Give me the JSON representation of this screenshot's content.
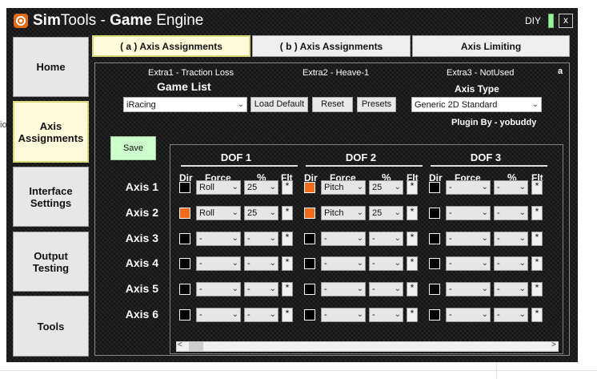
{
  "window": {
    "title_sim": "Sim",
    "title_tools": "Tools",
    "title_dash": " - ",
    "title_game": "Game",
    "title_engine": " Engine",
    "diy_label": "DIY",
    "close_label": "x"
  },
  "background": {
    "io_text": "io"
  },
  "sidebar": {
    "items": [
      {
        "label": "Home"
      },
      {
        "label": "Axis\nAssignments",
        "line1": "Axis",
        "line2": "Assignments",
        "active": true
      },
      {
        "line1": "Interface",
        "line2": "Settings"
      },
      {
        "line1": "Output",
        "line2": "Testing"
      },
      {
        "label": "Tools"
      }
    ]
  },
  "tabs": [
    {
      "label": "( a ) Axis Assignments",
      "active": true
    },
    {
      "label": "( b ) Axis Assignments"
    },
    {
      "label": "Axis Limiting"
    }
  ],
  "extras": {
    "extra1": "Extra1 - Traction Loss",
    "extra2": "Extra2 - Heave-1",
    "extra3": "Extra3 - NotUsed",
    "marker": "a"
  },
  "game": {
    "label": "Game List",
    "selected": "iRacing",
    "load_default": "Load Default",
    "reset": "Reset",
    "presets": "Presets"
  },
  "axis_type": {
    "label": "Axis Type",
    "selected": "Generic 2D Standard",
    "plugin_by": "Plugin By - yobuddy"
  },
  "save_label": "Save",
  "dof_titles": [
    "DOF 1",
    "DOF 2",
    "DOF 3"
  ],
  "columns": {
    "dir": "Dir",
    "force": "Force",
    "pct": "%",
    "flt": "Flt"
  },
  "axes": [
    {
      "label": "Axis 1",
      "dof": [
        {
          "dir": false,
          "force": "Roll",
          "pct": "25"
        },
        {
          "dir": true,
          "force": "Pitch",
          "pct": "25"
        },
        {
          "dir": false,
          "force": "-",
          "pct": "-"
        }
      ]
    },
    {
      "label": "Axis 2",
      "dof": [
        {
          "dir": true,
          "force": "Roll",
          "pct": "25"
        },
        {
          "dir": true,
          "force": "Pitch",
          "pct": "25"
        },
        {
          "dir": false,
          "force": "-",
          "pct": "-"
        }
      ]
    },
    {
      "label": "Axis 3",
      "dof": [
        {
          "dir": false,
          "force": "-",
          "pct": "-"
        },
        {
          "dir": false,
          "force": "-",
          "pct": "-"
        },
        {
          "dir": false,
          "force": "-",
          "pct": "-"
        }
      ]
    },
    {
      "label": "Axis 4",
      "dof": [
        {
          "dir": false,
          "force": "-",
          "pct": "-"
        },
        {
          "dir": false,
          "force": "-",
          "pct": "-"
        },
        {
          "dir": false,
          "force": "-",
          "pct": "-"
        }
      ]
    },
    {
      "label": "Axis 5",
      "dof": [
        {
          "dir": false,
          "force": "-",
          "pct": "-"
        },
        {
          "dir": false,
          "force": "-",
          "pct": "-"
        },
        {
          "dir": false,
          "force": "-",
          "pct": "-"
        }
      ]
    },
    {
      "label": "Axis 6",
      "dof": [
        {
          "dir": false,
          "force": "-",
          "pct": "-"
        },
        {
          "dir": false,
          "force": "-",
          "pct": "-"
        },
        {
          "dir": false,
          "force": "-",
          "pct": "-"
        }
      ]
    }
  ],
  "flt_glyph": "*",
  "scrollbar": {
    "left_arrow": "<",
    "right_arrow": ">"
  },
  "colors": {
    "checked": "#f26a1b",
    "diy_indicator": "#9cf29c",
    "save": "#ccffcc",
    "active_tab": "#fffbdb"
  }
}
